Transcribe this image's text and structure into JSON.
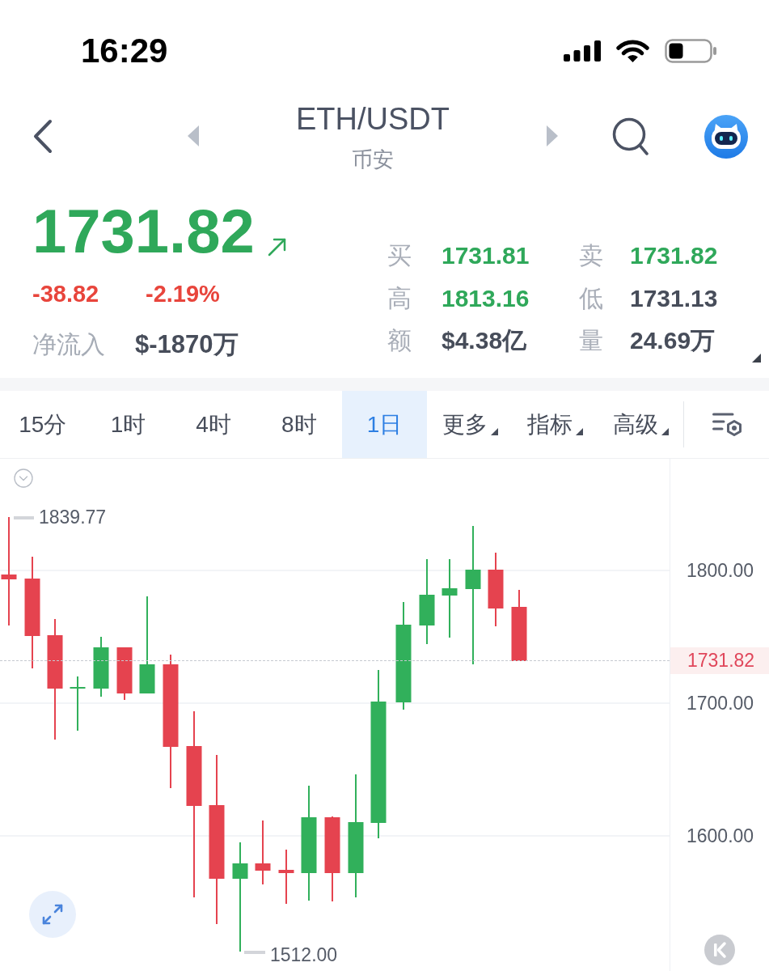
{
  "status_bar": {
    "time": "16:29"
  },
  "header": {
    "title": "ETH/USDT",
    "subtitle": "币安"
  },
  "quote": {
    "price": "1731.82",
    "change": "-38.82",
    "change_percent": "-2.19%",
    "net_inflow_label": "净流入",
    "net_inflow": "$-1870万",
    "stats": [
      {
        "label": "买",
        "value": "1731.81",
        "color": "#2fa85a"
      },
      {
        "label": "卖",
        "value": "1731.82",
        "color": "#2fa85a"
      },
      {
        "label": "高",
        "value": "1813.16",
        "color": "#2fa85a"
      },
      {
        "label": "低",
        "value": "1731.13",
        "color": "#474d5a"
      },
      {
        "label": "额",
        "value": "$4.38亿",
        "color": "#474d5a"
      },
      {
        "label": "量",
        "value": "24.69万",
        "color": "#474d5a"
      }
    ]
  },
  "tabs": [
    {
      "label": "15分",
      "kind": "interval",
      "selected": false
    },
    {
      "label": "1时",
      "kind": "interval",
      "selected": false
    },
    {
      "label": "4时",
      "kind": "interval",
      "selected": false
    },
    {
      "label": "8时",
      "kind": "interval",
      "selected": false
    },
    {
      "label": "1日",
      "kind": "interval",
      "selected": true
    },
    {
      "label": "更多",
      "kind": "dropdown",
      "selected": false
    },
    {
      "label": "指标",
      "kind": "dropdown",
      "selected": false
    },
    {
      "label": "高级",
      "kind": "dropdown",
      "selected": false
    }
  ],
  "chart": {
    "y_labels": [
      "1800.00",
      "1700.00",
      "1600.00"
    ],
    "last_price": "1731.82",
    "high_label": "1839.77",
    "low_label": "1512.00"
  }
}
